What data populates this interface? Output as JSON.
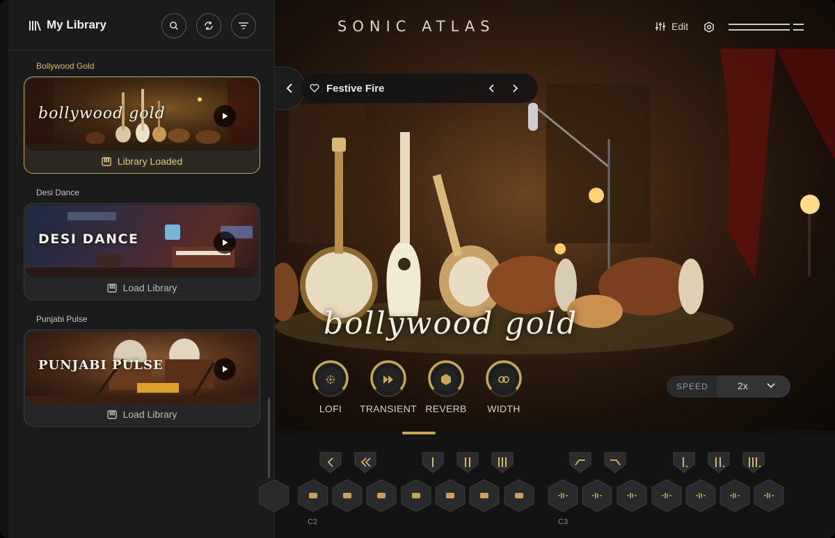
{
  "sidebar": {
    "title": "My Library",
    "sections": [
      {
        "label": "Bollywood Gold",
        "logo": "bollywood gold",
        "action": "Library Loaded",
        "active": true
      },
      {
        "label": "Desi Dance",
        "logo": "DESI DANCE",
        "action": "Load Library",
        "active": false
      },
      {
        "label": "Punjabi Pulse",
        "logo": "PUNJABI PULSE",
        "action": "Load Library",
        "active": false
      }
    ]
  },
  "header": {
    "brand": "SONIC ATLAS",
    "edit_label": "Edit"
  },
  "preset": {
    "name": "Festive Fire"
  },
  "stage": {
    "logo": "bollywood gold"
  },
  "knobs": [
    {
      "label": "LOFI",
      "icon": "lofi-icon"
    },
    {
      "label": "TRANSIENT",
      "icon": "fast-forward-icon"
    },
    {
      "label": "REVERB",
      "icon": "reverb-icon"
    },
    {
      "label": "WIDTH",
      "icon": "width-icon"
    }
  ],
  "speed": {
    "label": "SPEED",
    "value": "2x"
  },
  "keyboard": {
    "note_labels": [
      "C2",
      "C3"
    ]
  },
  "colors": {
    "accent": "#c6a557",
    "panel": "#1b1b1c"
  }
}
